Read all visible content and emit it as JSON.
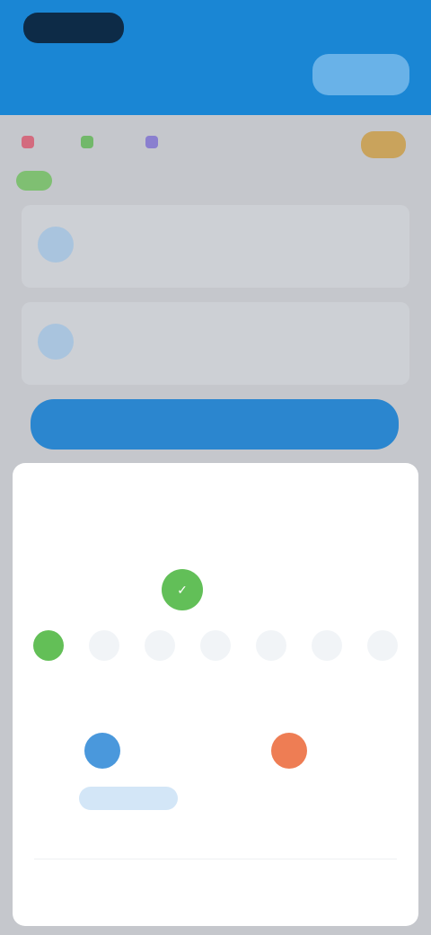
{
  "header": {
    "logo_text": "",
    "subtitle": "",
    "top_right": "",
    "button_label": ""
  },
  "bg": {
    "tabs": [
      {
        "label": "",
        "color": "#d36b7e"
      },
      {
        "label": "",
        "color": "#72b86a"
      },
      {
        "label": "",
        "color": "#8a7fcf"
      }
    ],
    "badge": "",
    "cards": [
      {
        "title": "",
        "desc": ""
      },
      {
        "title": "",
        "desc": ""
      }
    ],
    "primary_button": ""
  },
  "sheet": {
    "title": "",
    "subtitle": "",
    "streak": {
      "number": "",
      "label": ""
    },
    "week": [
      {
        "label": "",
        "done": true
      },
      {
        "label": "",
        "done": false
      },
      {
        "label": "",
        "done": false
      },
      {
        "label": "",
        "done": false
      },
      {
        "label": "",
        "done": false
      },
      {
        "label": "",
        "done": false
      },
      {
        "label": "",
        "done": false
      }
    ],
    "stats": [
      {
        "value": "",
        "label": "",
        "button": ""
      },
      {
        "value": "",
        "label": "",
        "button": ""
      }
    ],
    "footer_link": ""
  },
  "colors": {
    "accent": "#1a86d4",
    "success": "#63bf57",
    "warning": "#ee7d54",
    "dark": "#0d2b47"
  }
}
